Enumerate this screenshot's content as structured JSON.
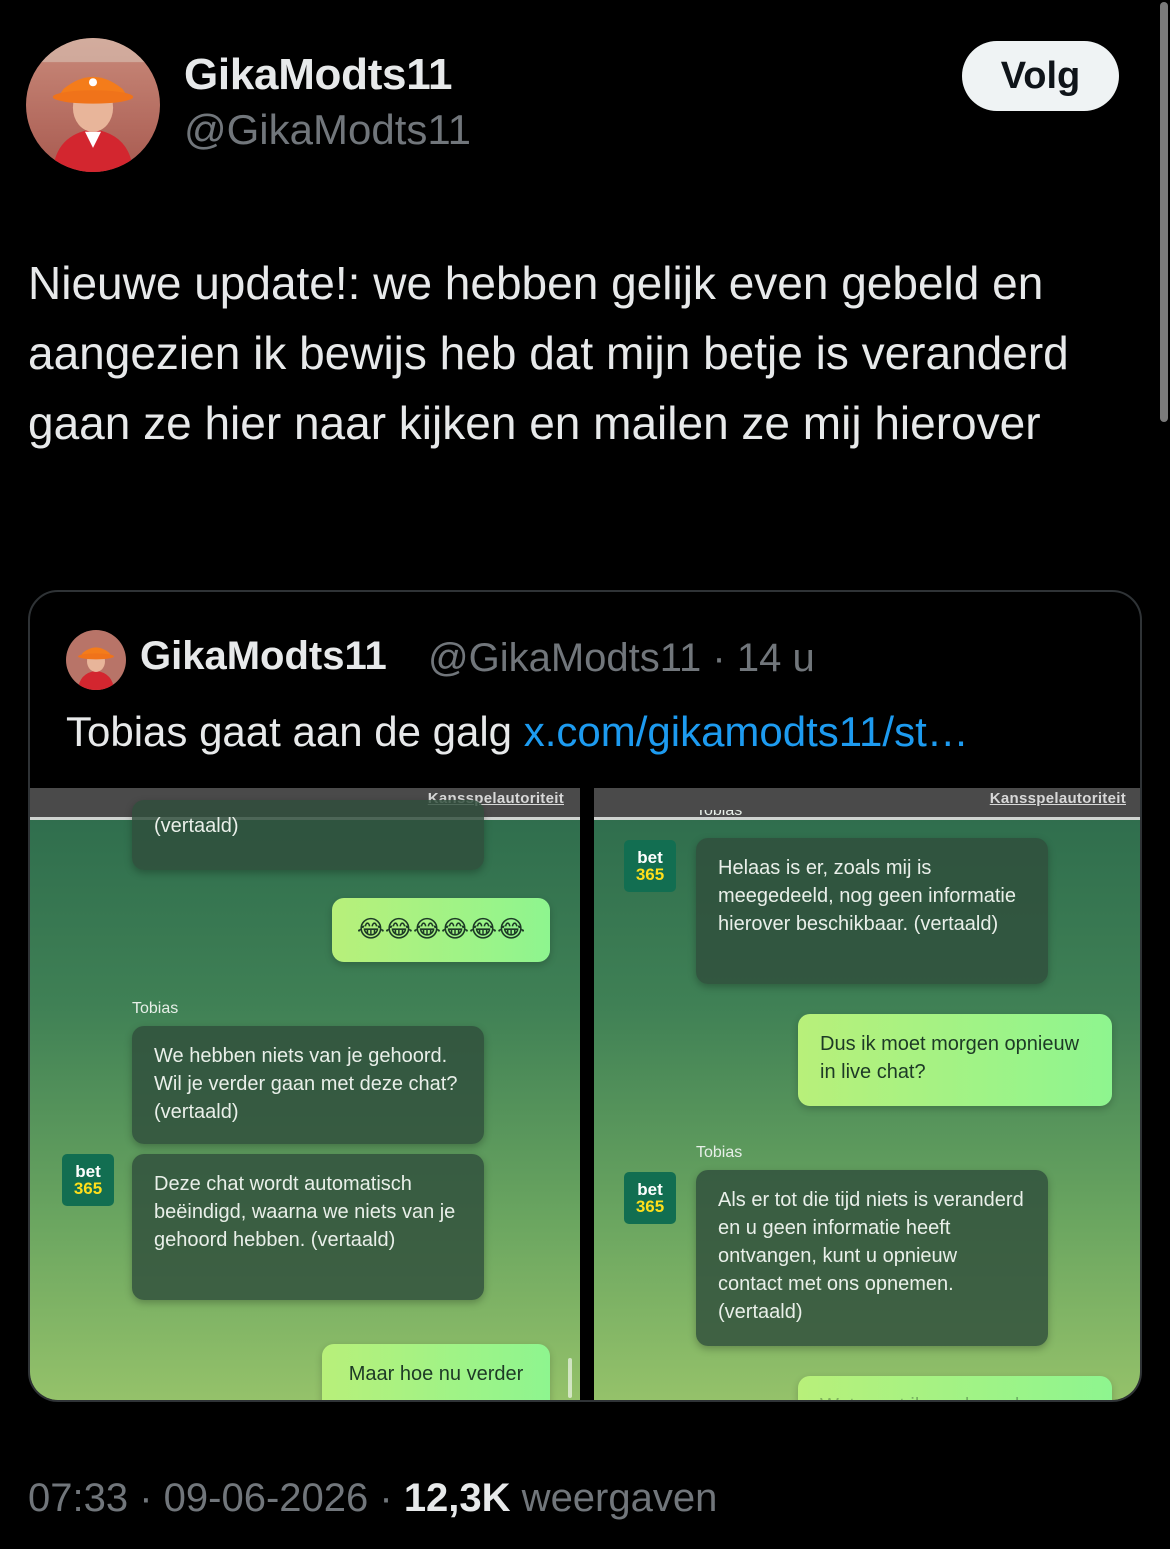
{
  "post": {
    "author_name": "GikaModts11",
    "author_handle": "@GikaModts11",
    "follow_label": "Volg",
    "text": "Nieuwe update!: we hebben gelijk even gebeld en aangezien ik bewijs heb dat mijn betje is veranderd gaan ze hier naar kijken en mailen ze mij hierover"
  },
  "quote": {
    "author_name": "GikaModts11",
    "meta": "@GikaModts11 · 14 u",
    "text": "Tobias gaat aan de galg ",
    "link": "x.com/gikamodts11/st…"
  },
  "chat_left": {
    "header_link": "Kansspelautoriteit",
    "partial_message": "(vertaald)",
    "user_emoji": "😂😂😂😂😂😂",
    "sender": "Tobias",
    "message_1": "We hebben niets van je gehoord. Wil je verder gaan met deze chat? (vertaald)",
    "message_2": "Deze chat wordt automatisch beëindigd, waarna we niets van je gehoord hebben. (vertaald)",
    "logo_top": "bet",
    "logo_bottom": "365",
    "user_message": "Maar hoe nu verder"
  },
  "chat_right": {
    "header_link": "Kansspelautoriteit",
    "sender_cut": "Tobias",
    "message_1": "Helaas is er, zoals mij is meegedeeld, nog geen informatie hierover beschikbaar. (vertaald)",
    "user_message": "Dus ik moet morgen opnieuw in live chat?",
    "sender": "Tobias",
    "message_2": "Als er tot die tijd niets is veranderd en u geen informatie heeft ontvangen, kunt u opnieuw contact met ons opnemen. (vertaald)",
    "logo_top": "bet",
    "logo_bottom": "365",
    "user_message_cut": "Wat moet ik nu doen dan"
  },
  "footer": {
    "time_date": "07:33 · 09-06-2026 · ",
    "views_count": "12,3K",
    "views_label": " weergaven"
  },
  "colors": {
    "background": "#000000",
    "link": "#1d9bf0",
    "muted": "#71767b",
    "bet365_green": "#126e51",
    "bet365_yellow": "#ffdf1b"
  }
}
